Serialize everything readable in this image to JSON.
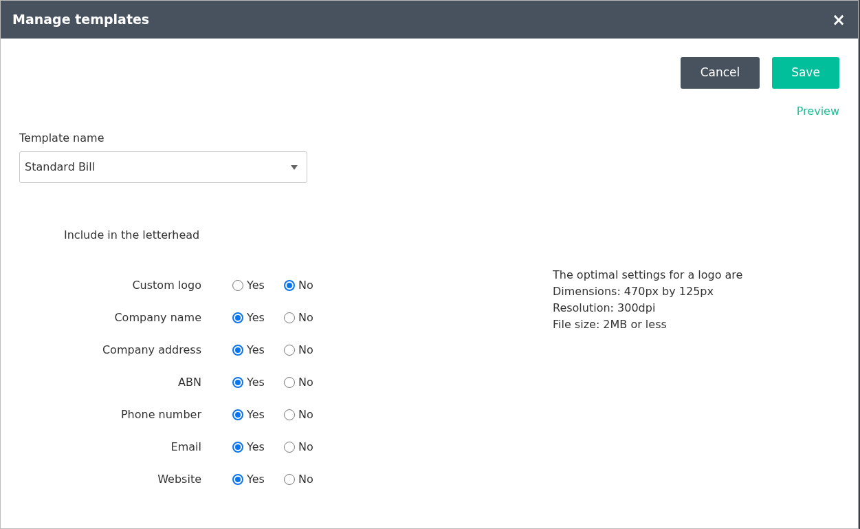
{
  "window": {
    "title": "Manage templates",
    "close": "×"
  },
  "actions": {
    "cancel": "Cancel",
    "save": "Save",
    "preview": "Preview"
  },
  "template_name": {
    "label": "Template name",
    "value": "Standard Bill"
  },
  "letterhead": {
    "heading": "Include in the letterhead",
    "rows": [
      {
        "label": "Custom logo",
        "options": [
          {
            "label": "Yes",
            "selected": false
          },
          {
            "label": "No",
            "selected": true
          }
        ]
      },
      {
        "label": "Company name",
        "options": [
          {
            "label": "Yes",
            "selected": true
          },
          {
            "label": "No",
            "selected": false
          }
        ]
      },
      {
        "label": "Company address",
        "options": [
          {
            "label": "Yes",
            "selected": true
          },
          {
            "label": "No",
            "selected": false
          }
        ]
      },
      {
        "label": "ABN",
        "options": [
          {
            "label": "Yes",
            "selected": true
          },
          {
            "label": "No",
            "selected": false
          }
        ]
      },
      {
        "label": "Phone number",
        "options": [
          {
            "label": "Yes",
            "selected": true
          },
          {
            "label": "No",
            "selected": false
          }
        ]
      },
      {
        "label": "Email",
        "options": [
          {
            "label": "Yes",
            "selected": true
          },
          {
            "label": "No",
            "selected": false
          }
        ]
      },
      {
        "label": "Website",
        "options": [
          {
            "label": "Yes",
            "selected": true
          },
          {
            "label": "No",
            "selected": false
          }
        ]
      }
    ]
  },
  "logo_info": [
    "The optimal settings for a logo are",
    "Dimensions: 470px by 125px",
    "Resolution: 300dpi",
    "File size: 2MB or less"
  ]
}
